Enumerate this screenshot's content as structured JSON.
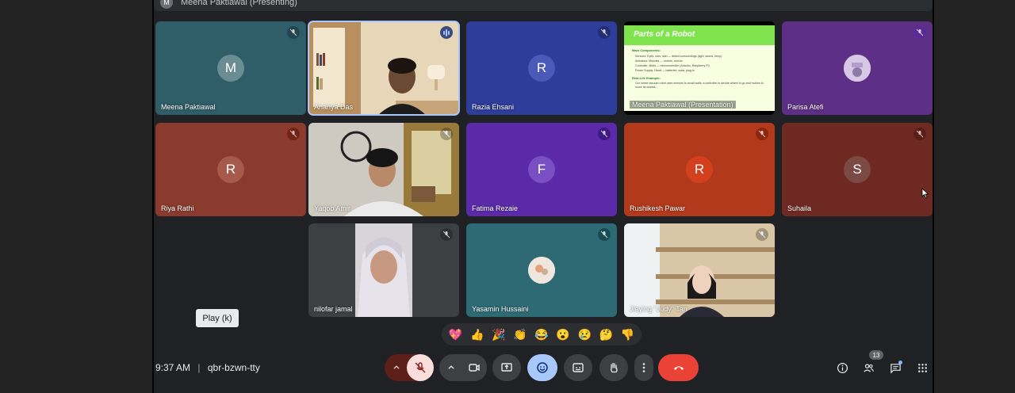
{
  "presenter_bar": {
    "avatar_initial": "M",
    "text": "Meena Paktiawal (Presenting)"
  },
  "tiles": [
    {
      "name": "Meena Paktiawal",
      "initial": "M",
      "bg": "#2f5d68",
      "avatar_bg": "#6a8c93"
    },
    {
      "name": "Ananya Das",
      "bg": "#d9c8ac",
      "type": "video"
    },
    {
      "name": "Razia Ehsani",
      "initial": "R",
      "bg": "#2f3d9a",
      "avatar_bg": "#4b5ab8"
    },
    {
      "name": "Meena Paktiawal (Presentation)",
      "type": "slide"
    },
    {
      "name": "Parisa Atefi",
      "bg": "#5e2f86",
      "type": "photo"
    },
    {
      "name": "Riya Rathi",
      "initial": "R",
      "bg": "#8a3b2e",
      "avatar_bg": "#a55a4c"
    },
    {
      "name": "Yaqob Amir",
      "bg": "#c9c4bb",
      "type": "video"
    },
    {
      "name": "Fatima Rezaie",
      "initial": "F",
      "bg": "#5a2aa8",
      "avatar_bg": "#7a4fc4"
    },
    {
      "name": "Rushikesh Pawar",
      "initial": "R",
      "bg": "#b3391c",
      "avatar_bg": "#d4401e"
    },
    {
      "name": "Suhaila",
      "initial": "S",
      "bg": "#6e2a22",
      "avatar_bg": "#7c4a44"
    },
    {
      "name": "nilofar jamal",
      "bg": "#3c4043",
      "type": "video"
    },
    {
      "name": "Yasamin Hussaini",
      "bg": "#2d6a73",
      "type": "photo"
    },
    {
      "name": "Jieying \"Judy\" Tan",
      "bg": "#b8a58a",
      "type": "video"
    }
  ],
  "slide": {
    "title": "Parts of a Robot",
    "heading1": "Main Components:",
    "lines": [
      "Sensors: Eyes, ears, skin — detect surroundings (light, sound, temp)",
      "Actuators: Muscles — motors, servos",
      "Controller: Brain — microcontroller (Arduino, Raspberry Pi)",
      "Power Supply: Heart — batteries, solar, plug-in"
    ],
    "heading2": "Real-Life Example:",
    "example": "Our smart vacuum robot uses sensors to avoid walls, a controller to decide where to go and motors to move its wheels."
  },
  "tooltip": "Play (k)",
  "reactions": [
    "💖",
    "👍",
    "🎉",
    "👏",
    "😂",
    "😮",
    "😢",
    "🤔",
    "👎"
  ],
  "meeting": {
    "time": "9:37 AM",
    "separator": "|",
    "code": "qbr-bzwn-tty"
  },
  "participants_count": "13",
  "colors": {
    "end_call": "#ea4335",
    "mic_off": "#f9dedc",
    "emoji_active": "#a8c7fa",
    "accent": "#8ab4f8"
  }
}
